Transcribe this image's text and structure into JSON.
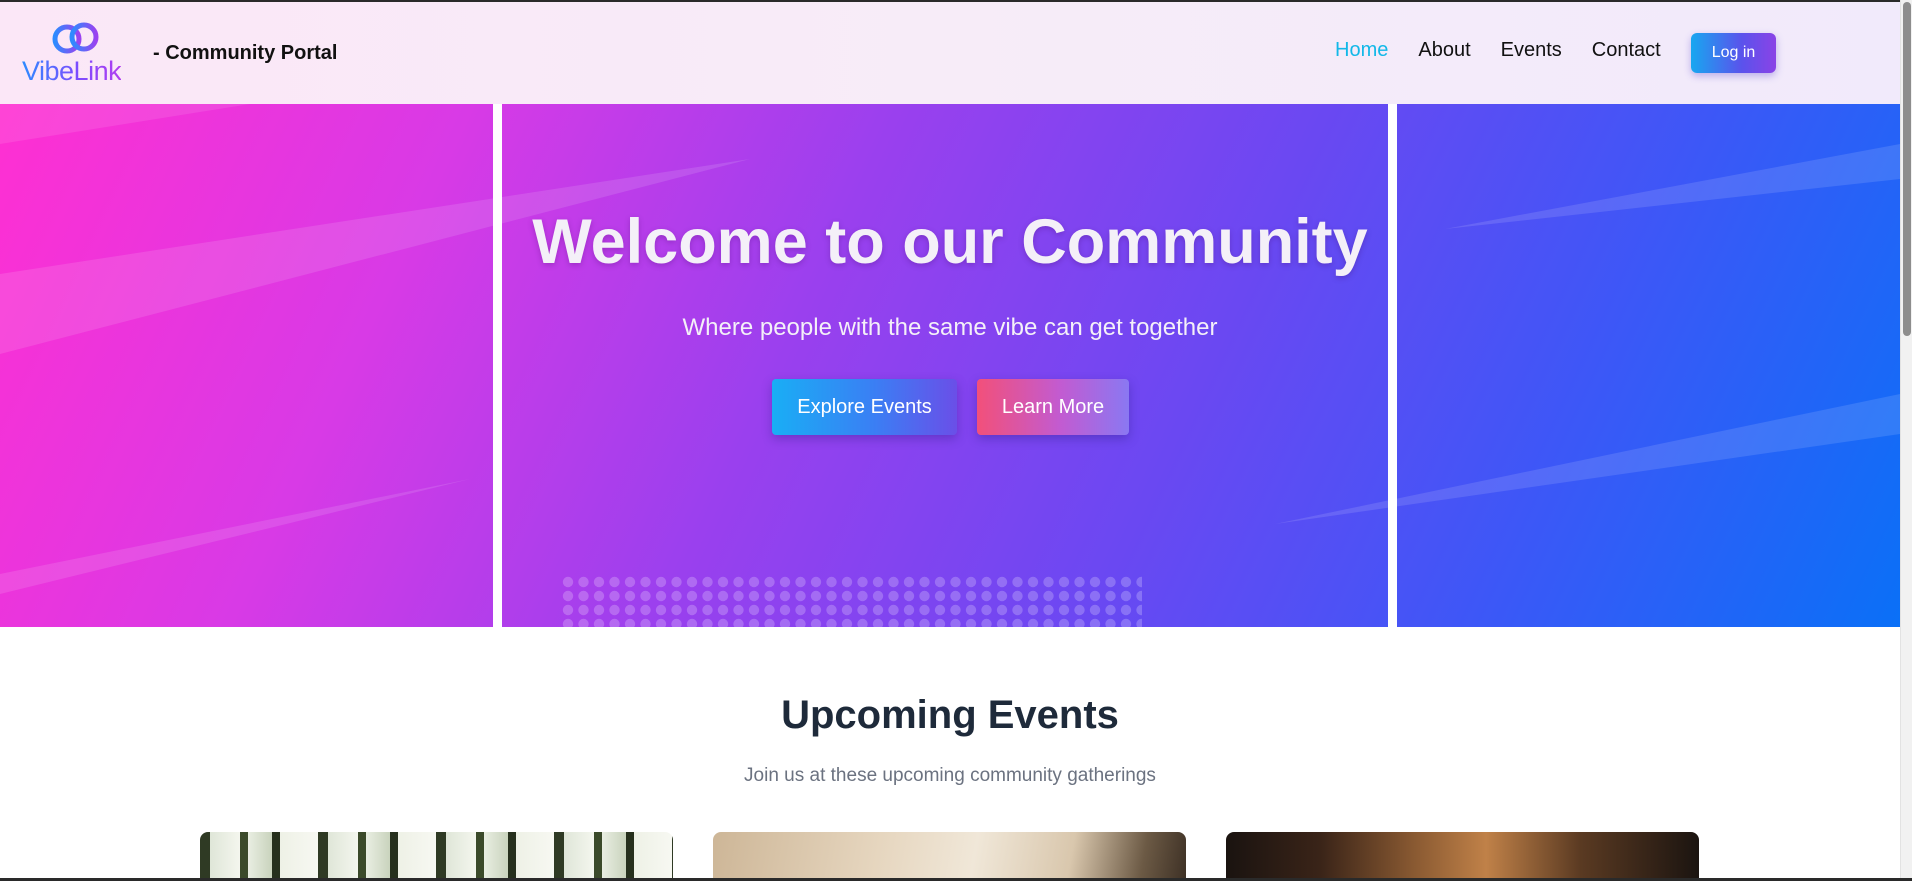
{
  "navbar": {
    "logo_text": "VibeLink",
    "portal_title": "- Community Portal",
    "links": [
      {
        "label": "Home",
        "active": true
      },
      {
        "label": "About",
        "active": false
      },
      {
        "label": "Events",
        "active": false
      },
      {
        "label": "Contact",
        "active": false
      }
    ],
    "login_label": "Log in"
  },
  "hero": {
    "title": "Welcome to our Community",
    "subtitle": "Where people with the same vibe can get together",
    "explore_label": "Explore Events",
    "learn_label": "Learn More"
  },
  "events": {
    "title": "Upcoming Events",
    "subtitle": "Join us at these upcoming community gatherings"
  },
  "colors": {
    "nav_active": "#12b8e8",
    "hero_gradient_start": "#ff2fd2",
    "hero_gradient_end": "#0a70f7",
    "heading_dark": "#1e2a3a"
  },
  "icons": {
    "logo": "linked-rings-icon"
  }
}
